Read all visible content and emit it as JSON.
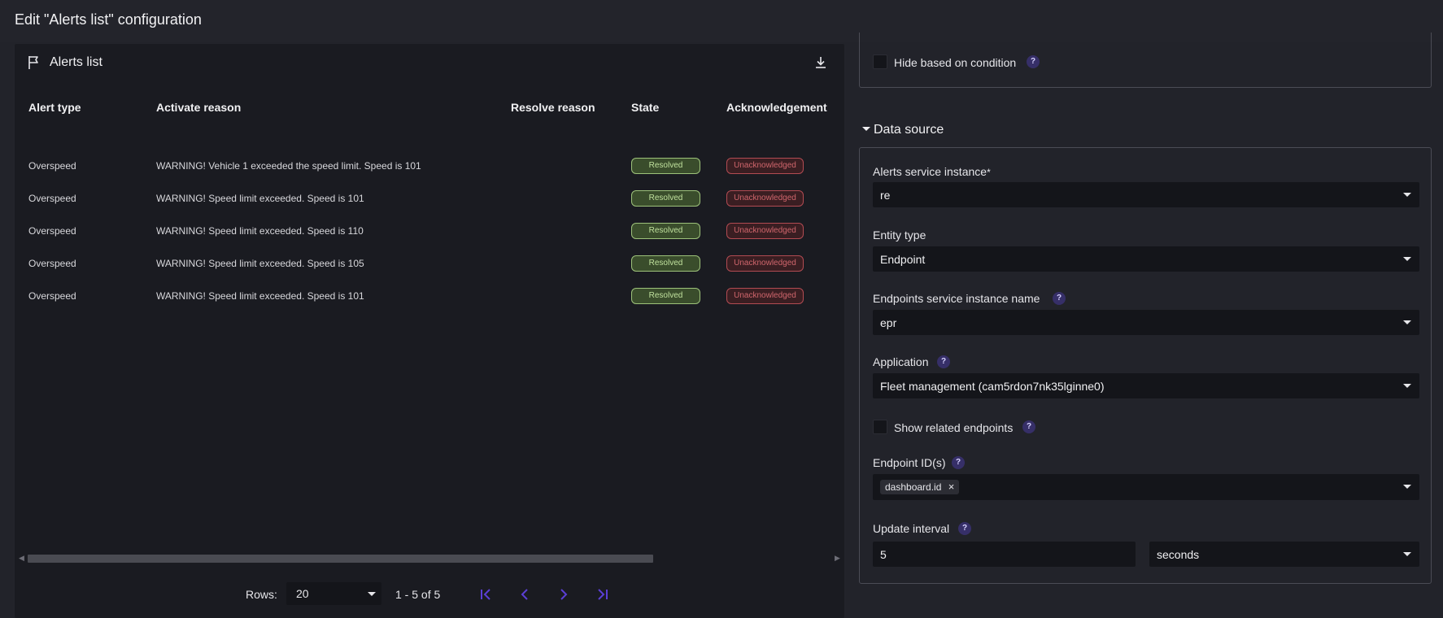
{
  "page": {
    "title": "Edit \"Alerts list\" configuration"
  },
  "widget": {
    "title": "Alerts list",
    "columns": [
      "Alert type",
      "Activate reason",
      "Resolve reason",
      "State",
      "Acknowledgement"
    ],
    "rows": [
      {
        "alert_type": "Overspeed",
        "activate_reason": "WARNING! Vehicle 1 exceeded the speed limit. Speed is 101",
        "resolve_reason": "",
        "state": "Resolved",
        "ack": "Unacknowledged"
      },
      {
        "alert_type": "Overspeed",
        "activate_reason": "WARNING! Speed limit exceeded. Speed is 101",
        "resolve_reason": "",
        "state": "Resolved",
        "ack": "Unacknowledged"
      },
      {
        "alert_type": "Overspeed",
        "activate_reason": "WARNING! Speed limit exceeded. Speed is 110",
        "resolve_reason": "",
        "state": "Resolved",
        "ack": "Unacknowledged"
      },
      {
        "alert_type": "Overspeed",
        "activate_reason": "WARNING! Speed limit exceeded. Speed is 105",
        "resolve_reason": "",
        "state": "Resolved",
        "ack": "Unacknowledged"
      },
      {
        "alert_type": "Overspeed",
        "activate_reason": "WARNING! Speed limit exceeded. Speed is 101",
        "resolve_reason": "",
        "state": "Resolved",
        "ack": "Unacknowledged"
      }
    ],
    "pager": {
      "rows_label": "Rows:",
      "rows_value": "20",
      "range": "1 - 5 of 5"
    },
    "icons": {
      "title": "flag-icon",
      "download": "download-icon",
      "first": "first-page-icon",
      "prev": "prev-page-icon",
      "next": "next-page-icon",
      "last": "last-page-icon"
    },
    "colors": {
      "resolved": "#9dc27a",
      "unacknowledged": "#b24b52",
      "pager_icons": "#5b3fd6"
    }
  },
  "config": {
    "hide_condition": {
      "label": "Hide based on condition",
      "checked": false
    },
    "data_source": {
      "title": "Data source",
      "alerts_service": {
        "label": "Alerts service instance",
        "required_mark": "*",
        "value": "re"
      },
      "entity_type": {
        "label": "Entity type",
        "value": "Endpoint"
      },
      "endpoints_service": {
        "label": "Endpoints service instance name",
        "value": "epr"
      },
      "application": {
        "label": "Application",
        "value": "Fleet management (cam5rdon7nk35lginne0)"
      },
      "show_related": {
        "label": "Show related endpoints",
        "checked": false
      },
      "endpoint_ids": {
        "label": "Endpoint ID(s)",
        "tags": [
          "dashboard.id"
        ],
        "tag_remove": "×"
      },
      "update_interval": {
        "label": "Update interval",
        "value": "5",
        "unit": "seconds"
      }
    },
    "help_glyph": "?"
  }
}
